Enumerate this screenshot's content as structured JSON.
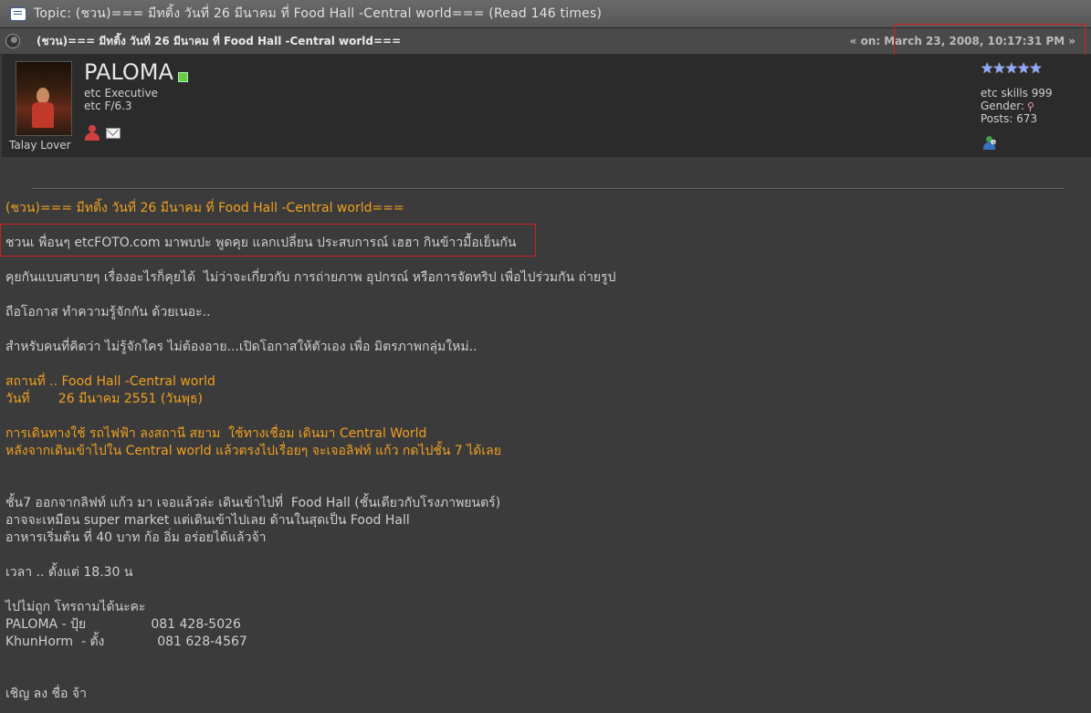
{
  "topic": {
    "label": "Topic: (ชวน)=== มีทติ้ง วันที่ 26 มีนาคม ที่ Food Hall -Central world===  (Read 146 times)"
  },
  "post": {
    "subject": "(ชวน)=== มีทติ้ง วันที่ 26 มีนาคม ที่ Food Hall -Central world===",
    "on_label": "« on:",
    "date": "March 23, 2008, 10:17:31 PM",
    "arrow": "»"
  },
  "poster": {
    "name": "PALOMA",
    "member_group": "etc Executive",
    "camera": "etc F/6.3",
    "personal_text": "Talay Lover",
    "stars": "★★★★★",
    "skills": "etc skills 999",
    "gender_label": "Gender:",
    "posts": "Posts: 673"
  },
  "body": {
    "title": "(ชวน)=== มีทติ้ง วันที่ 26 มีนาคม ที่ Food Hall -Central world===",
    "invite": "ชวนเ พื่อนๆ etcFOTO.com มาพบปะ พูดคุย แลกเปลี่ยน ประสบการณ์ เฮฮา กินข้าวมื้อเย็นกัน",
    "chat": "คุยกันแบบสบายๆ เรื่องอะไรก็คุยได้  ไม่ว่าจะเกี่ยวกับ การถ่ายภาพ อุปกรณ์ หรือการจัดทริป เพื่อไปร่วมกัน ถ่ายรูป",
    "chance": "ถือโอกาส ทำความรู้จักกัน ด้วยเนอะ..",
    "newcomers": "สำหรับคนที่คิดว่า ไม่รู้จักใคร ไม่ต้องอาย...เปิดโอกาสให้ตัวเอง เพื่อ มิตรภาพกลุ่มใหม่..",
    "place": "สถานที่ .. Food Hall -Central world",
    "date_line": "วันที่       26 มีนาคม 2551 (วันพุธ)",
    "travel1": "การเดินทางใช้ รถไฟฟ้า ลงสถานี สยาม  ใช้ทางเชื่อม เดินมา Central World",
    "travel2": "หลังจากเดินเข้าไปใน Central world แล้วตรงไปเรื่อยๆ จะเจอลิฟท์ แก้ว กดไปชั้น 7 ได้เลย",
    "floor1": "ชั้น7 ออกจากลิฟท์ แก้ว มา เจอแล้วล่ะ เดินเข้าไปที่  Food Hall (ชั้นเดียวกับโรงภาพยนตร์)",
    "floor2": "อาจจะเหมือน super market แต่เดินเข้าไปเลย ด้านในสุดเป็น Food Hall",
    "floor3": "อาหารเริ่มต้น ที่ 40 บาท ก้อ อิ่ม อร่อยได้แล้วจ้า",
    "time": "เวลา .. ตั้งแต่ 18.30 น",
    "lost": "ไปไม่ถูก โทรถามได้นะคะ",
    "contact1": "PALOMA - ปุ้ย                081 428-5026",
    "contact2": "KhunHorm  - ตั้ง             081 628-4567",
    "signup": "เชิญ ลง ชื่อ จ้า"
  },
  "colors": {
    "accent": "#f0a020",
    "highlight": "#d02020"
  },
  "icons": [
    "topic-icon",
    "post-icon",
    "online-icon",
    "profile-icon",
    "email-icon",
    "star-icon",
    "gender-female-icon",
    "msn-icon"
  ]
}
